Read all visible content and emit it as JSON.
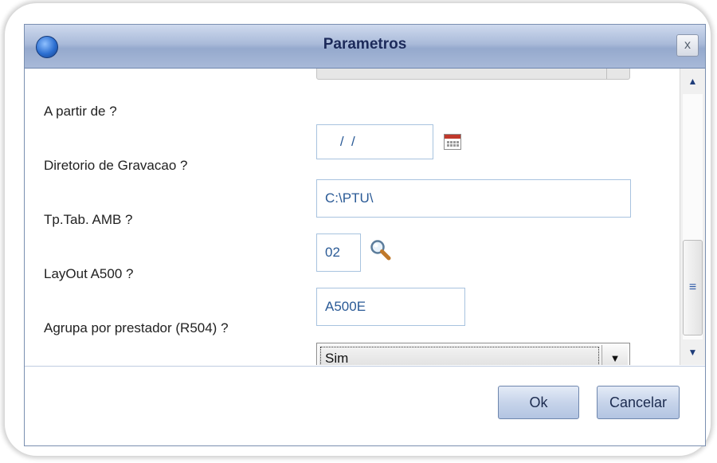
{
  "dialog": {
    "title": "Parametros",
    "close_label": "x"
  },
  "form": {
    "fields": [
      {
        "label": "A partir de ?",
        "value": "    /  /"
      },
      {
        "label": "Diretorio de Gravacao ?",
        "value": "C:\\PTU\\"
      },
      {
        "label": "Tp.Tab. AMB ?",
        "value": "02"
      },
      {
        "label": "LayOut A500 ?",
        "value": "A500E"
      },
      {
        "label": "Agrupa por prestador (R504) ?",
        "value": "Sim"
      }
    ]
  },
  "icons": {
    "app": "app-logo-icon",
    "calendar": "calendar-icon",
    "search": "search-icon",
    "dropdown": "chevron-down-icon"
  },
  "scrollbar": {
    "up_glyph": "▲",
    "down_glyph": "▼",
    "thumb_glyph": "≡"
  },
  "buttons": {
    "ok_label": "Ok",
    "cancel_label": "Cancelar"
  },
  "colors": {
    "titlebar": "#a9bad9",
    "field_border": "#a8c3df",
    "field_text": "#2a5a96",
    "button": "#c7d4ea"
  }
}
